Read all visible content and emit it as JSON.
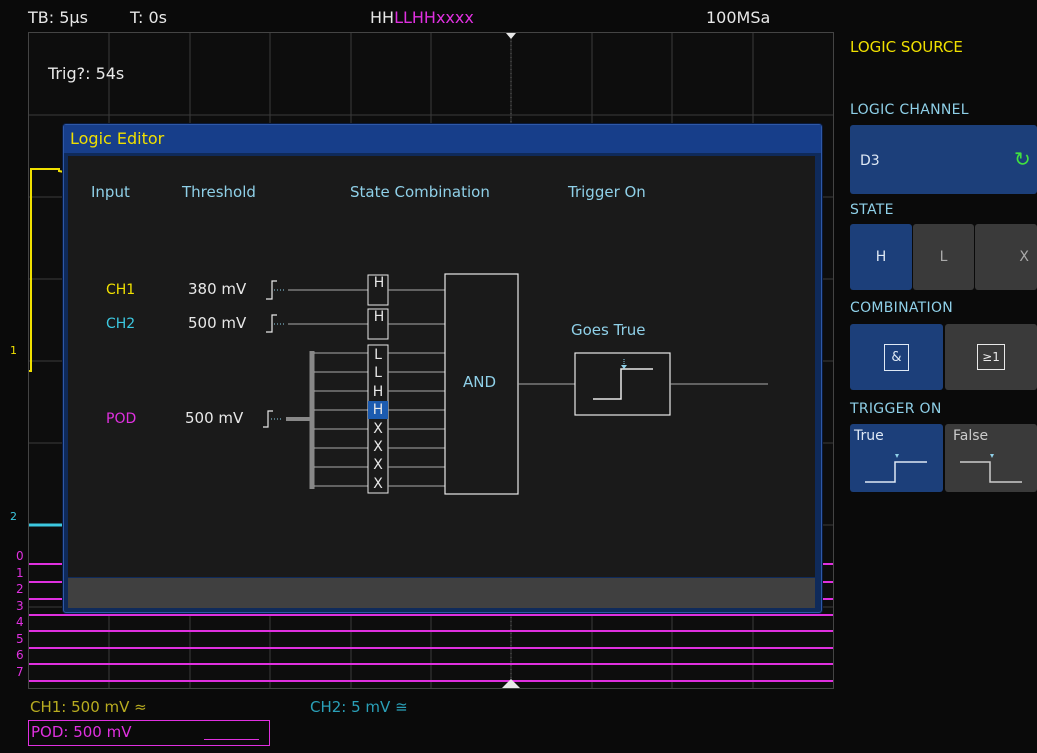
{
  "status": {
    "timebase": "TB: 5µs",
    "trigger_time": "T: 0s",
    "pattern_prefix": "HH",
    "pattern_suffix": "LLHHxxxx",
    "sample_rate": "100MSa",
    "trigger_wait": "Trig?: 54s"
  },
  "right_panel": {
    "title": "LOGIC SOURCE",
    "logic_channel_head": "LOGIC CHANNEL",
    "logic_channel_value": "D3",
    "state_head": "STATE",
    "state_options": [
      "H",
      "L",
      "X"
    ],
    "combination_head": "COMBINATION",
    "combination_options": [
      "&",
      "≥1"
    ],
    "trigger_on_head": "TRIGGER ON",
    "trigger_on_options": [
      "True",
      "False"
    ]
  },
  "dialog": {
    "title": "Logic Editor",
    "col_input": "Input",
    "col_threshold": "Threshold",
    "col_state": "State Combination",
    "col_trigger": "Trigger On",
    "rows": [
      {
        "input": "CH1",
        "threshold": "380 mV",
        "color": "#f0e000"
      },
      {
        "input": "CH2",
        "threshold": "500 mV",
        "color": "#3cc8e0"
      },
      {
        "input": "POD",
        "threshold": "500 mV",
        "color": "#e030e0"
      }
    ],
    "ch_states": [
      "H",
      "H"
    ],
    "pod_states": [
      "L",
      "L",
      "H",
      "H",
      "X",
      "X",
      "X",
      "X"
    ],
    "gate_label": "AND",
    "trigger_label": "Goes True"
  },
  "bottom": {
    "ch1": "CH1: 500 mV ≈",
    "ch2": "CH2: 5 mV ≅",
    "pod": "POD: 500 mV"
  },
  "channel_markers": [
    "1",
    "2",
    "0",
    "1",
    "2",
    "3",
    "4",
    "5",
    "6",
    "7"
  ],
  "colors": {
    "ch1": "#f0e000",
    "ch2": "#3cc8e0",
    "pod": "#e030e0",
    "accent": "#1c3f7a"
  }
}
